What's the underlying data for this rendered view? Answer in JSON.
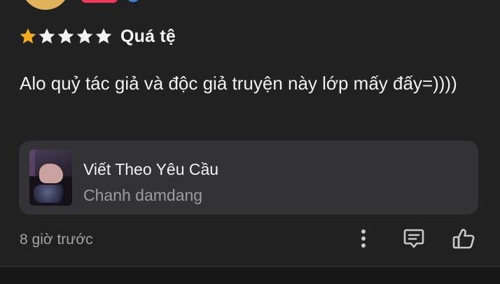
{
  "review": {
    "rating": {
      "value": 1,
      "max": 5,
      "label": "Quá tệ"
    },
    "text": "Alo quỷ tác giả và độc giả truyện này lớp mấy đấy=))))",
    "story": {
      "title": "Viết Theo Yêu Cầu",
      "author": "Chanh damdang"
    },
    "time": "8 giờ trước"
  },
  "icons": {
    "more": "more-vertical-icon",
    "reply": "comment-reply-icon",
    "like": "thumbs-up-icon",
    "verified": "verified-badge-icon"
  },
  "colors": {
    "background": "#212122",
    "card": "#333335",
    "star_filled": "#f6ad1b",
    "star_empty": "#f2f2f2",
    "muted_text": "#9d9d9f",
    "badge": "#f0385a"
  }
}
